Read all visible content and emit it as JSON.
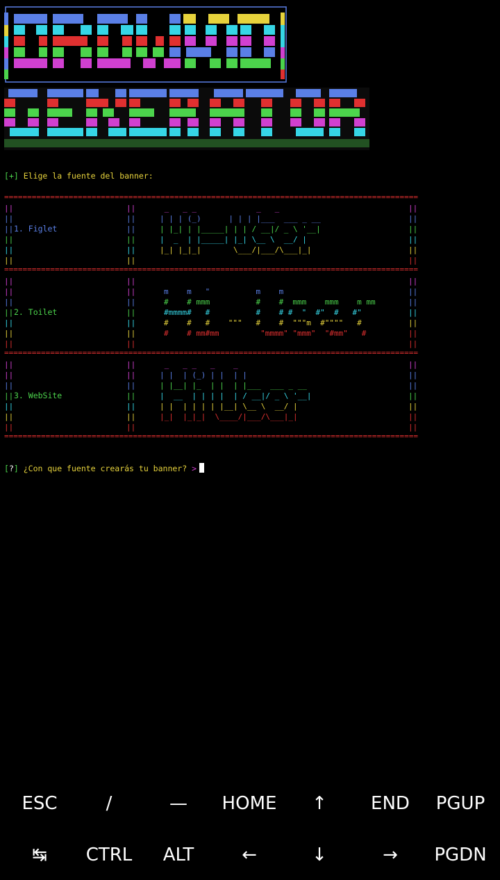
{
  "prompt": {
    "bracket_open": "[",
    "plus": "+",
    "bracket_close": "]",
    "choose_text": " Elige la fuente del banner:"
  },
  "options": [
    {
      "label": "1. Figlet",
      "color": "#5a7fe6"
    },
    {
      "label": "2. Toilet",
      "color": "#4cd44c"
    },
    {
      "label": "3. WebSite",
      "color": "#4cd44c"
    }
  ],
  "question": {
    "bracket_open": "[",
    "mark": "?",
    "bracket_close": "]",
    "text": " ¿Con que fuente crearás tu banner? ",
    "arrow": ">"
  },
  "separator": "================================================================================================",
  "figlet_art": [
    " _   _ _             _   _",
    "| | | (_)      | | | |___  ___ _ __",
    "| |_| | |_____| | | / __|/ _ \\ '__|",
    "|  _  | |_____| |_| \\__ \\  __/ |",
    "|_| |_|_|       \\___/|___/\\___|_|"
  ],
  "toilet_art": [
    "m    m   \"          m    m",
    "#    # mmm          #    #  mmm    mmm    m mm",
    "#mmmm#   #          #    # #  \"  #\"  #   #\"",
    "#    #   #    \"\"\"   #    #  \"\"\"m  #\"\"\"\"   #",
    "#    # mm#mm         \"mmmm\" \"mmm\"  \"#mm\"   #"
  ],
  "website_art": [
    " _   _ _   _    _",
    "| |  | (_) | |  | |",
    "| |__| |_  | |  | |___  ___ _ __",
    "|  __  | | | |  | / __|/ _ \\ '__|",
    "| |  | | | | |__| \\__ \\  __/ |",
    "|_|  |_|_|  \\____/|___/\\___|_|"
  ],
  "keys": {
    "row1": [
      "ESC",
      "/",
      "—",
      "HOME",
      "↑",
      "END",
      "PGUP"
    ],
    "row2": [
      "↹",
      "CTRL",
      "ALT",
      "←",
      "↓",
      "→",
      "PGDN"
    ]
  }
}
